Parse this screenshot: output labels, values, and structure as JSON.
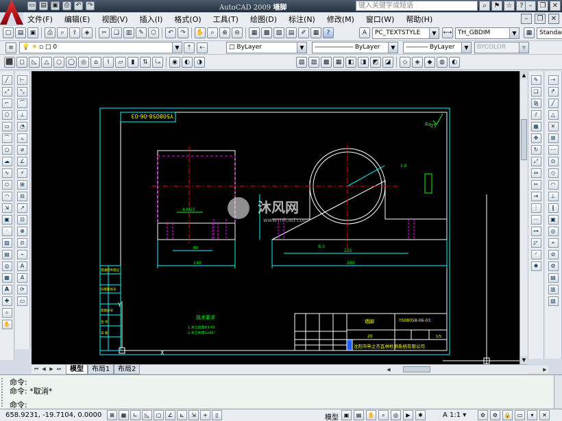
{
  "titlebar": {
    "app_title": "AutoCAD 2009",
    "doc_title": "墙脚",
    "search_placeholder": "键入关键字或短语"
  },
  "menu": [
    "文件(F)",
    "编辑(E)",
    "视图(V)",
    "插入(I)",
    "格式(O)",
    "工具(T)",
    "绘图(D)",
    "标注(N)",
    "修改(M)",
    "窗口(W)",
    "帮助(H)"
  ],
  "toolbar": {
    "text_style": "PC_TEXTSTYLE",
    "dim_style": "TH_GBDIM",
    "table_style": "Standar",
    "layer_value": "0",
    "color": "ByLayer",
    "linetype": "ByLayer",
    "lineweight": "ByLayer",
    "plotstyle": "BYCOLOR"
  },
  "drawing": {
    "title_strip": "Y508058-06-03",
    "detail_label": "4-M22",
    "dim_80": "80",
    "dim_140": "140",
    "dim_222": "222",
    "dim_280": "280",
    "dim_slope": "1.6",
    "section_mark": "B-3",
    "ra_label": "Ra",
    "ra_value": "25",
    "tech_req_title": "技术要求",
    "tech_req_1": "1.未注圆角R3-R5",
    "tech_req_2": "2.未注倒角1x45°",
    "part_name": "墙脚",
    "drawing_number": "YS08058-06-03",
    "quantity": "20",
    "scale": "1/5",
    "company": "沈阳市申之杰瓦林检测系统有限公司",
    "side_table": [
      "借通用件登记",
      "",
      "旧底图总号",
      "",
      "底图总号",
      "",
      "签 字",
      "日 期"
    ],
    "watermark_name": "沐风网",
    "watermark_url": "www.mfcad.com"
  },
  "tabs": [
    "模型",
    "布局1",
    "布局2"
  ],
  "command": {
    "line1": "命令:",
    "line2": "命令: *取消*",
    "line3": "命令:"
  },
  "status": {
    "coords": "658.9231, -19.7104, 0.0000",
    "model_label": "模型",
    "annotation_scale": "1:1"
  },
  "colors": {
    "canvas": "#000000",
    "frame": "#00ffff",
    "outline": "#ffffff",
    "hidden": "#ff00ff",
    "centerline": "#ff0000",
    "dimension": "#00ff00",
    "title_text": "#ffff00"
  }
}
